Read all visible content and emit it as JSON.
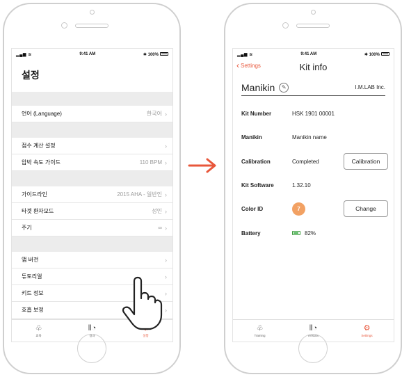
{
  "status": {
    "time": "9:41 AM",
    "battery": "100%"
  },
  "left": {
    "title": "설정",
    "rows": {
      "language": {
        "label": "언어 (Language)",
        "value": "한국어"
      },
      "score": {
        "label": "점수 계산 설정"
      },
      "guide": {
        "label": "압박 속도 가이드",
        "value": "110 BPM"
      },
      "guideline": {
        "label": "가이드라인",
        "value": "2015 AHA - 일반인"
      },
      "target": {
        "label": "타겟 환자모드",
        "value": "성인"
      },
      "cycle": {
        "label": "주기",
        "value": "∞"
      },
      "version": {
        "label": "앱 버전"
      },
      "tutorial": {
        "label": "튜토리얼"
      },
      "kitinfo": {
        "label": "키트 정보"
      },
      "breath": {
        "label": "호흡 보정"
      }
    },
    "tabs": {
      "training": "교육",
      "results": "결과",
      "settings": "설정"
    }
  },
  "right": {
    "back": "Settings",
    "title": "Kit info",
    "kit_name": "Manikin",
    "brand": "I.M.LAB Inc.",
    "kit_number": {
      "label": "Kit Number",
      "value": "HSK 1901 00001"
    },
    "manikin": {
      "label": "Manikin",
      "value": "Manikin name"
    },
    "calibration": {
      "label": "Calibration",
      "value": "Completed",
      "button": "Calibration"
    },
    "software": {
      "label": "Kit Software",
      "value": "1.32.10"
    },
    "color": {
      "label": "Color ID",
      "value": "7",
      "button": "Change",
      "swatch": "#f2a163"
    },
    "battery": {
      "label": "Battery",
      "value": "82%"
    },
    "tabs": {
      "training": "Training",
      "results": "Results",
      "settings": "Settings"
    }
  },
  "accent": "#e8573b"
}
